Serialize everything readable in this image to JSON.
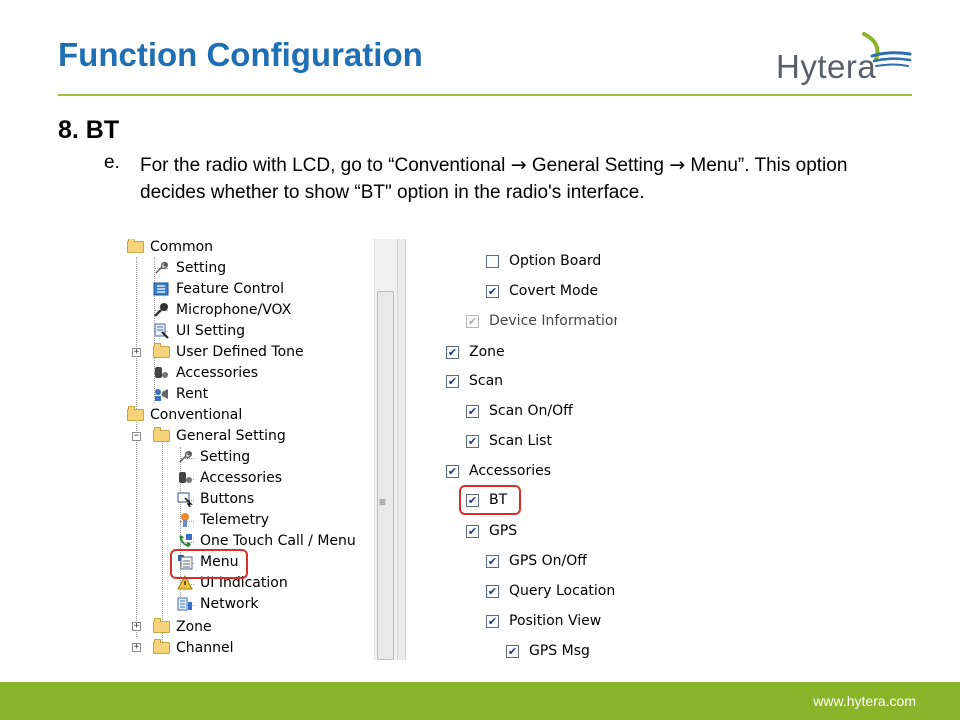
{
  "slide": {
    "title": "Function Configuration",
    "logo_text": "Hytera",
    "section_heading": "8. BT",
    "step_letter": "e.",
    "step_text_1": "For the radio with LCD, go to “Conventional ",
    "step_text_2": " General Setting ",
    "step_text_3": " Menu”. This option decides whether to show “BT\" option in the radio's interface.",
    "arrow": "→",
    "footer_url": "www.hytera.com"
  },
  "colors": {
    "title": "#1f6fb4",
    "accent_green": "#8ab42a",
    "highlight_red": "#d6302b"
  },
  "tree": {
    "common": "Common",
    "common_setting": "Setting",
    "feature_control": "Feature Control",
    "microphone_vox": "Microphone/VOX",
    "ui_setting": "UI Setting",
    "user_defined_tone": "User Defined Tone",
    "common_accessories": "Accessories",
    "rent": "Rent",
    "conventional": "Conventional",
    "general_setting": "General Setting",
    "gs_setting": "Setting",
    "gs_accessories": "Accessories",
    "buttons": "Buttons",
    "telemetry": "Telemetry",
    "one_touch_call_menu": "One Touch Call / Menu",
    "menu": "Menu",
    "ui_indication": "UI Indication",
    "network": "Network",
    "zone": "Zone",
    "channel": "Channel"
  },
  "checklist": {
    "option_board": "Option Board",
    "covert_mode": "Covert Mode",
    "device_information": "Device Information",
    "zone": "Zone",
    "scan": "Scan",
    "scan_on_off": "Scan On/Off",
    "scan_list": "Scan List",
    "accessories": "Accessories",
    "bt": "BT",
    "gps": "GPS",
    "gps_on_off": "GPS On/Off",
    "query_location": "Query Location",
    "position_view": "Position View",
    "gps_msg": "GPS Msg",
    "check_mark": "✔"
  }
}
